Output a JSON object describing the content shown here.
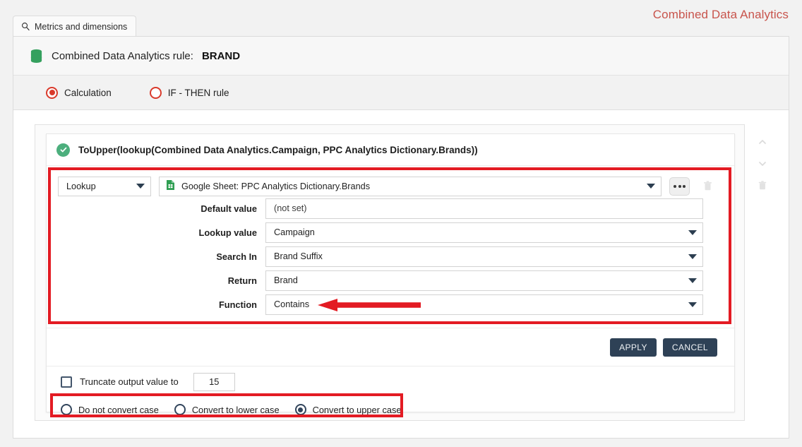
{
  "app": {
    "title": "Combined Data Analytics"
  },
  "tab": {
    "label": "Metrics and dimensions",
    "icon": "search-icon"
  },
  "rule_header": {
    "icon": "database-icon",
    "label": "Combined Data Analytics rule:",
    "value": "BRAND"
  },
  "mode": {
    "options": [
      {
        "label": "Calculation",
        "selected": true
      },
      {
        "label": "IF - THEN rule",
        "selected": false
      }
    ]
  },
  "formula": {
    "status_icon": "check-circle-icon",
    "text": "ToUpper(lookup(Combined Data Analytics.Campaign, PPC Analytics Dictionary.Brands))"
  },
  "lookup_row": {
    "type_value": "Lookup",
    "source_icon": "google-sheet-icon",
    "source_value": "Google Sheet: PPC Analytics Dictionary.Brands",
    "more_button": "more-options-icon",
    "delete_button": "trash-icon"
  },
  "fields": [
    {
      "label": "Default value",
      "value": "(not set)",
      "control": "text"
    },
    {
      "label": "Lookup value",
      "value": "Campaign",
      "control": "select"
    },
    {
      "label": "Search In",
      "value": "Brand Suffix",
      "control": "select"
    },
    {
      "label": "Return",
      "value": "Brand",
      "control": "select"
    },
    {
      "label": "Function",
      "value": "Contains",
      "control": "select"
    }
  ],
  "buttons": {
    "apply": "APPLY",
    "cancel": "CANCEL"
  },
  "truncate": {
    "checked": false,
    "label": "Truncate output value to",
    "value": "15"
  },
  "case_options": [
    {
      "label": "Do not convert case",
      "selected": false
    },
    {
      "label": "Convert to lower case",
      "selected": false
    },
    {
      "label": "Convert to upper case",
      "selected": true
    }
  ],
  "tools": [
    {
      "name": "move-up-icon"
    },
    {
      "name": "move-down-icon"
    },
    {
      "name": "delete-rule-icon"
    }
  ],
  "colors": {
    "accent_red": "#e31b23",
    "title_red": "#c8544c",
    "radio_red": "#d93a2b",
    "button_navy": "#2e4156",
    "success_green": "#4caf7d",
    "page_bg": "#f2f2f2"
  }
}
